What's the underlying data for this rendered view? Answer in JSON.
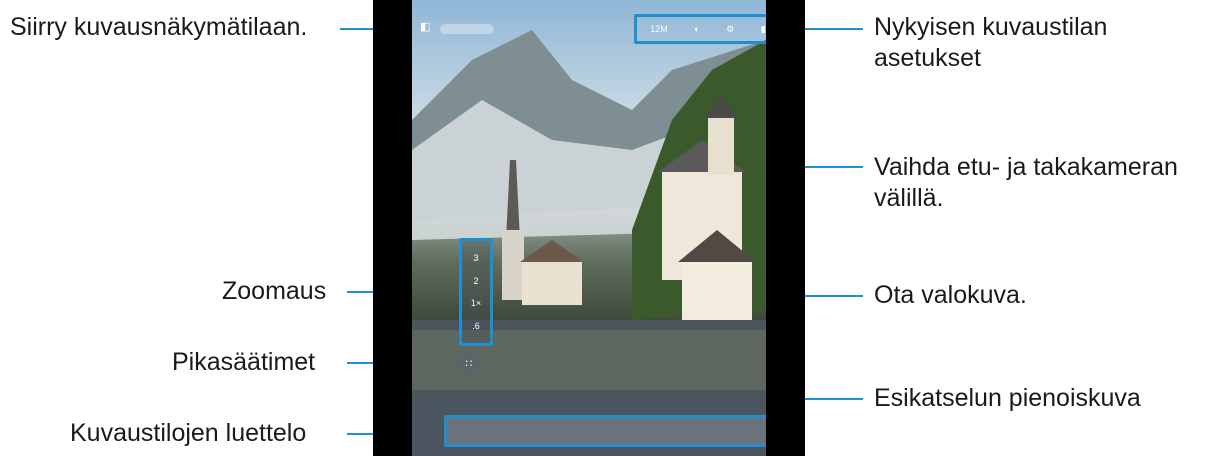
{
  "callouts": {
    "view_mode": "Siirry kuvausnäkymätilaan.",
    "zoom": "Zoomaus",
    "quick_controls": "Pikasäätimet",
    "mode_list": "Kuvaustilojen luettelo",
    "current_mode_settings_line1": "Nykyisen kuvaustilan",
    "current_mode_settings_line2": "asetukset",
    "switch_camera_line1": "Vaihda etu- ja takakameran",
    "switch_camera_line2": "välillä.",
    "take_photo": "Ota valokuva.",
    "preview_thumbnail": "Esikatselun pienoiskuva"
  },
  "settings_bar": {
    "items": [
      "12M",
      "◐",
      "⚙",
      "▮"
    ]
  },
  "zoom_levels": [
    "3",
    "2",
    "1×",
    ".6"
  ],
  "colors": {
    "callout_line": "#1f8fd0",
    "text": "#1a1a1a"
  }
}
